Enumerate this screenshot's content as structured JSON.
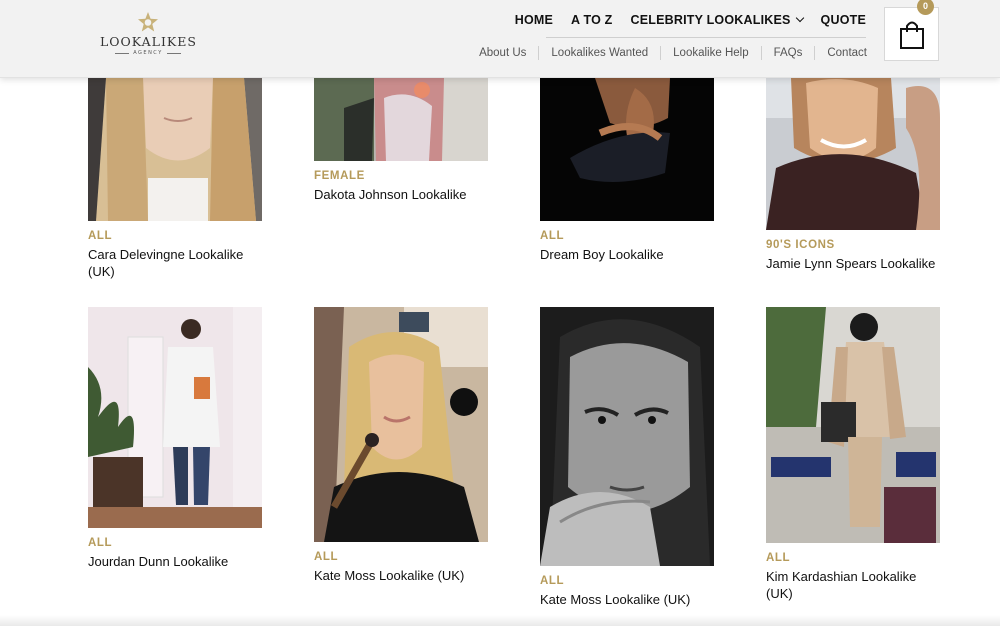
{
  "header": {
    "logo": {
      "word": "LOOKALIKES",
      "sub": "AGENCY"
    },
    "main_nav": [
      {
        "label": "HOME"
      },
      {
        "label": "A TO Z"
      },
      {
        "label": "CELEBRITY LOOKALIKES",
        "has_dropdown": true
      },
      {
        "label": "QUOTE"
      }
    ],
    "sub_nav": [
      {
        "label": "About Us"
      },
      {
        "label": "Lookalikes Wanted"
      },
      {
        "label": "Lookalike Help"
      },
      {
        "label": "FAQs"
      },
      {
        "label": "Contact"
      }
    ],
    "cart": {
      "count": "0",
      "icon": "shopping-bag-icon"
    }
  },
  "colors": {
    "accent": "#b59a5a",
    "header_bg": "#f2f2f2",
    "text": "#111111"
  },
  "cards": [
    {
      "category": "ALL",
      "name": "Cara Delevingne Lookalike (UK)"
    },
    {
      "category": "FEMALE",
      "name": "Dakota Johnson Lookalike"
    },
    {
      "category": "ALL",
      "name": "Dream Boy Lookalike"
    },
    {
      "category": "90'S ICONS",
      "name": "Jamie Lynn Spears Lookalike"
    },
    {
      "category": "ALL",
      "name": "Jourdan Dunn Lookalike"
    },
    {
      "category": "ALL",
      "name": "Kate Moss Lookalike (UK)"
    },
    {
      "category": "ALL",
      "name": "Kate Moss Lookalike (UK)"
    },
    {
      "category": "ALL",
      "name": "Kim Kardashian Lookalike (UK)"
    }
  ]
}
